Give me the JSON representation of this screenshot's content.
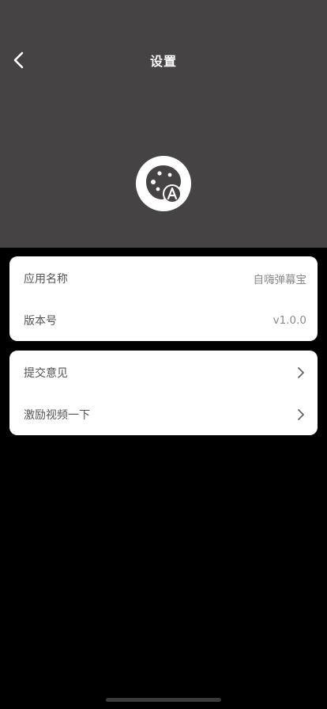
{
  "header": {
    "title": "设置",
    "background_color": "#454344",
    "back_icon": "chevron-left-icon",
    "logo_icon": "palette-letter-a-logo"
  },
  "app_info": {
    "app_name_label": "应用名称",
    "app_name_value": "自嗨弹幕宝",
    "version_label": "版本号",
    "version_value": "v1.0.0"
  },
  "actions": {
    "feedback_label": "提交意见",
    "reward_video_label": "激励视频一下",
    "chevron_icon": "chevron-right-icon"
  },
  "colors": {
    "page_background": "#000000",
    "card_background": "#ffffff",
    "label_text": "#555555",
    "value_text": "#8a8a8a"
  }
}
